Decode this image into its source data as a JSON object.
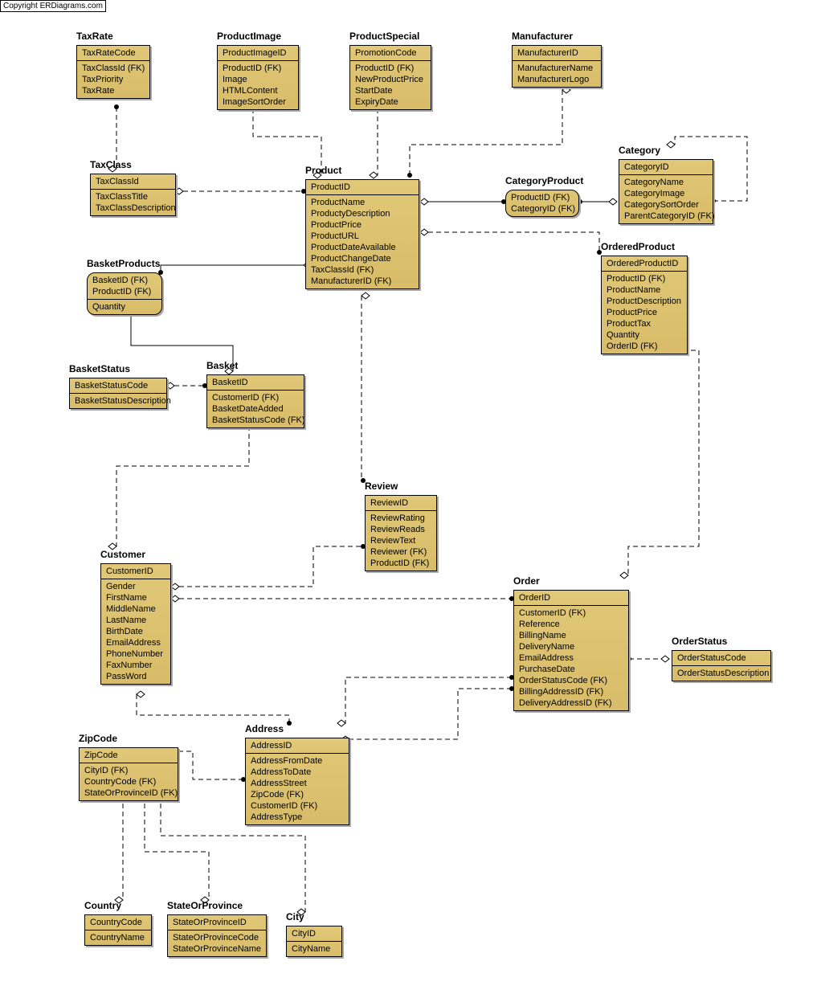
{
  "copyright": "Copyright ERDiagrams.com",
  "entities": {
    "TaxRate": {
      "title": "TaxRate",
      "pk": [
        "TaxRateCode"
      ],
      "attrs": [
        "TaxClassId (FK)",
        "TaxPriority",
        "TaxRate"
      ]
    },
    "ProductImage": {
      "title": "ProductImage",
      "pk": [
        "ProductImageID"
      ],
      "attrs": [
        "ProductID (FK)",
        "Image",
        "HTMLContent",
        "ImageSortOrder"
      ]
    },
    "ProductSpecial": {
      "title": "ProductSpecial",
      "pk": [
        "PromotionCode"
      ],
      "attrs": [
        "ProductID (FK)",
        "NewProductPrice",
        "StartDate",
        "ExpiryDate"
      ]
    },
    "Manufacturer": {
      "title": "Manufacturer",
      "pk": [
        "ManufacturerID"
      ],
      "attrs": [
        "ManufacturerName",
        "ManufacturerLogo"
      ]
    },
    "Category": {
      "title": "Category",
      "pk": [
        "CategoryID"
      ],
      "attrs": [
        "CategoryName",
        "CategoryImage",
        "CategorySortOrder",
        "ParentCategoryID (FK)"
      ]
    },
    "TaxClass": {
      "title": "TaxClass",
      "pk": [
        "TaxClassId"
      ],
      "attrs": [
        "TaxClassTitle",
        "TaxClassDescription"
      ]
    },
    "Product": {
      "title": "Product",
      "pk": [
        "ProductID"
      ],
      "attrs": [
        "ProductName",
        "ProductyDescription",
        "ProductPrice",
        "ProductURL",
        "ProductDateAvailable",
        "ProductChangeDate",
        "TaxClassId (FK)",
        "ManufacturerID (FK)"
      ]
    },
    "CategoryProduct": {
      "title": "CategoryProduct",
      "pk": [
        "ProductID (FK)",
        "CategoryID (FK)"
      ],
      "attrs": []
    },
    "OrderedProduct": {
      "title": "OrderedProduct",
      "pk": [
        "OrderedProductID"
      ],
      "attrs": [
        "ProductID (FK)",
        "ProductName",
        "ProductDescription",
        "ProductPrice",
        "ProductTax",
        "Quantity",
        "OrderID (FK)"
      ]
    },
    "BasketProducts": {
      "title": "BasketProducts",
      "pk": [
        "BasketID (FK)",
        "ProductID (FK)"
      ],
      "attrs": [
        "Quantity"
      ]
    },
    "Basket": {
      "title": "Basket",
      "pk": [
        "BasketID"
      ],
      "attrs": [
        "CustomerID (FK)",
        "BasketDateAdded",
        "BasketStatusCode (FK)"
      ]
    },
    "BasketStatus": {
      "title": "BasketStatus",
      "pk": [
        "BasketStatusCode"
      ],
      "attrs": [
        "BasketStatusDescription"
      ]
    },
    "Review": {
      "title": "Review",
      "pk": [
        "ReviewID"
      ],
      "attrs": [
        "ReviewRating",
        "ReviewReads",
        "ReviewText",
        "Reviewer (FK)",
        "ProductID (FK)"
      ]
    },
    "Customer": {
      "title": "Customer",
      "pk": [
        "CustomerID"
      ],
      "attrs": [
        "Gender",
        "FirstName",
        "MiddleName",
        "LastName",
        "BirthDate",
        "EmailAddress",
        "PhoneNumber",
        "FaxNumber",
        "PassWord"
      ]
    },
    "Order": {
      "title": "Order",
      "pk": [
        "OrderID"
      ],
      "attrs": [
        "CustomerID (FK)",
        "Reference",
        "BillingName",
        "DeliveryName",
        "EmailAddress",
        "PurchaseDate",
        "OrderStatusCode (FK)",
        "BillingAddressID (FK)",
        "DeliveryAddressID (FK)"
      ]
    },
    "OrderStatus": {
      "title": "OrderStatus",
      "pk": [
        "OrderStatusCode"
      ],
      "attrs": [
        "OrderStatusDescription"
      ]
    },
    "Address": {
      "title": "Address",
      "pk": [
        "AddressID"
      ],
      "attrs": [
        "AddressFromDate",
        "AddressToDate",
        "AddressStreet",
        "ZipCode (FK)",
        "CustomerID (FK)",
        "AddressType"
      ]
    },
    "ZipCode": {
      "title": "ZipCode",
      "pk": [
        "ZipCode"
      ],
      "attrs": [
        "CityID (FK)",
        "CountryCode (FK)",
        "StateOrProvinceID (FK)"
      ]
    },
    "Country": {
      "title": "Country",
      "pk": [
        "CountryCode"
      ],
      "attrs": [
        "CountryName"
      ]
    },
    "StateOrProvince": {
      "title": "StateOrProvince",
      "pk": [
        "StateOrProvinceID"
      ],
      "attrs": [
        "StateOrProvinceCode",
        "StateOrProvinceName"
      ]
    },
    "City": {
      "title": "City",
      "pk": [
        "CityID"
      ],
      "attrs": [
        "CityName"
      ]
    }
  }
}
